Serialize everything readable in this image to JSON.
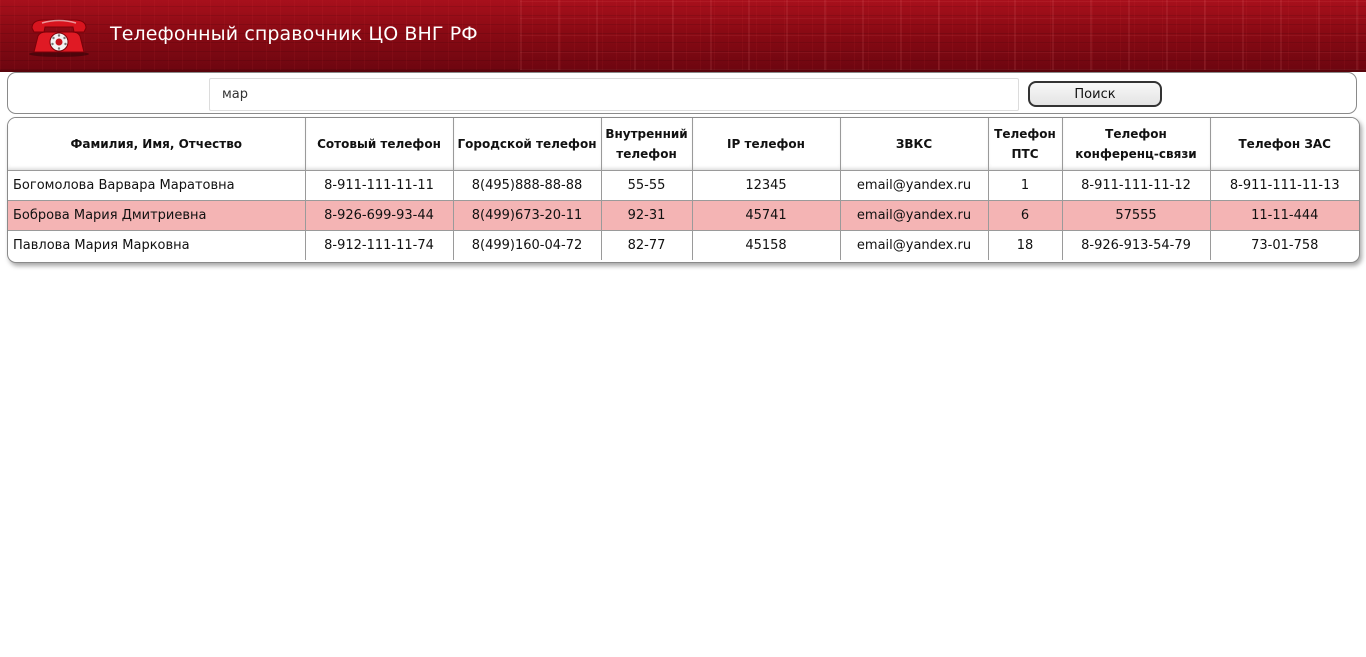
{
  "header": {
    "title": "Телефонный справочник ЦО ВНГ РФ",
    "logo_icon": "red-telephone-icon",
    "accent_color": "#8a0a14"
  },
  "search": {
    "value": "мар",
    "placeholder": "",
    "button_label": "Поиск"
  },
  "table": {
    "columns": [
      "Фамилия, Имя, Отчество",
      "Сотовый телефон",
      "Городской телефон",
      "Внутренний телефон",
      "IP телефон",
      "ЗВКС",
      "Телефон ПТС",
      "Телефон конференц-связи",
      "Телефон ЗАС"
    ],
    "highlight_color": "#f4b4b4",
    "rows": [
      {
        "highlighted": false,
        "cells": [
          "Богомолова Варвара Маратовна",
          "8-911-111-11-11",
          "8(495)888-88-88",
          "55-55",
          "12345",
          "email@yandex.ru",
          "1",
          "8-911-111-11-12",
          "8-911-111-11-13"
        ]
      },
      {
        "highlighted": true,
        "cells": [
          "Боброва Мария Дмитриевна",
          "8-926-699-93-44",
          "8(499)673-20-11",
          "92-31",
          "45741",
          "email@yandex.ru",
          "6",
          "57555",
          "11-11-444"
        ]
      },
      {
        "highlighted": false,
        "cells": [
          "Павлова Мария Марковна",
          "8-912-111-11-74",
          "8(499)160-04-72",
          "82-77",
          "45158",
          "email@yandex.ru",
          "18",
          "8-926-913-54-79",
          "73-01-758"
        ]
      }
    ]
  }
}
